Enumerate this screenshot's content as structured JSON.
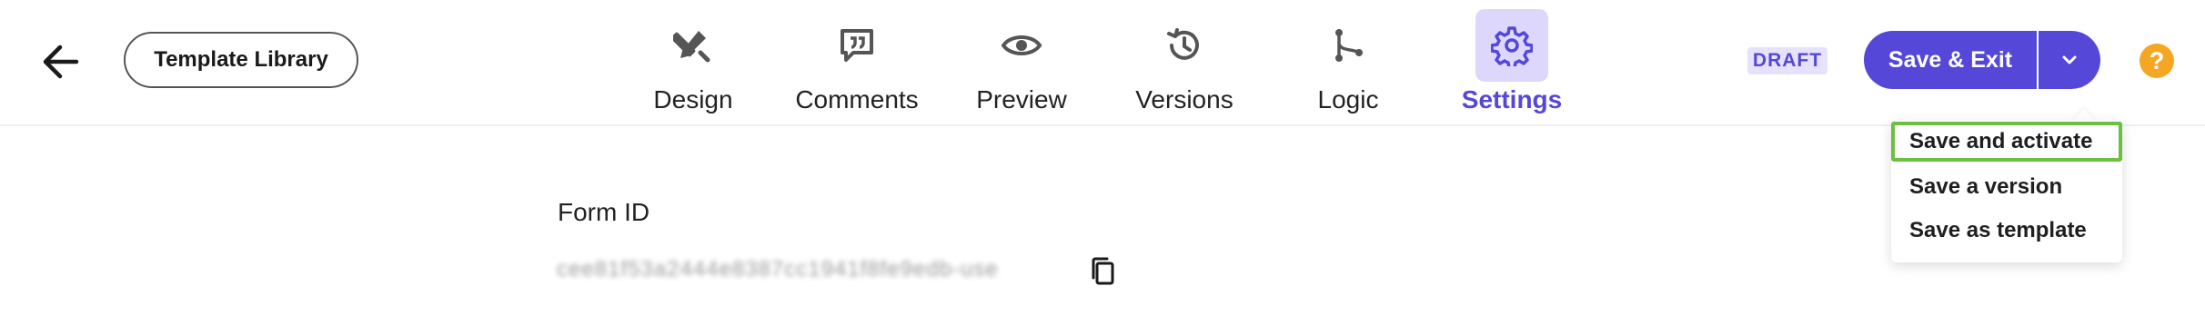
{
  "header": {
    "back_icon": "arrow-left-icon",
    "template_library_label": "Template Library",
    "tabs": [
      {
        "label": "Design",
        "icon": "design-tools-icon"
      },
      {
        "label": "Comments",
        "icon": "comment-quote-icon"
      },
      {
        "label": "Preview",
        "icon": "eye-icon"
      },
      {
        "label": "Versions",
        "icon": "history-icon"
      },
      {
        "label": "Logic",
        "icon": "branch-icon"
      },
      {
        "label": "Settings",
        "icon": "gear-icon",
        "active": true
      }
    ],
    "status_badge": "DRAFT",
    "save_exit_label": "Save & Exit",
    "help_label": "?"
  },
  "dropdown": {
    "items": [
      {
        "label": "Save and activate",
        "highlighted": true
      },
      {
        "label": "Save a version"
      },
      {
        "label": "Save as template"
      }
    ]
  },
  "content": {
    "form_id_label": "Form ID",
    "form_id_value": "cee81f53a2444e8387cc1941f8fe9edb-use"
  },
  "colors": {
    "accent": "#5547d8",
    "accent_soft": "#ddd8fb",
    "highlight_border": "#6cbf3f",
    "help": "#f5a623"
  }
}
